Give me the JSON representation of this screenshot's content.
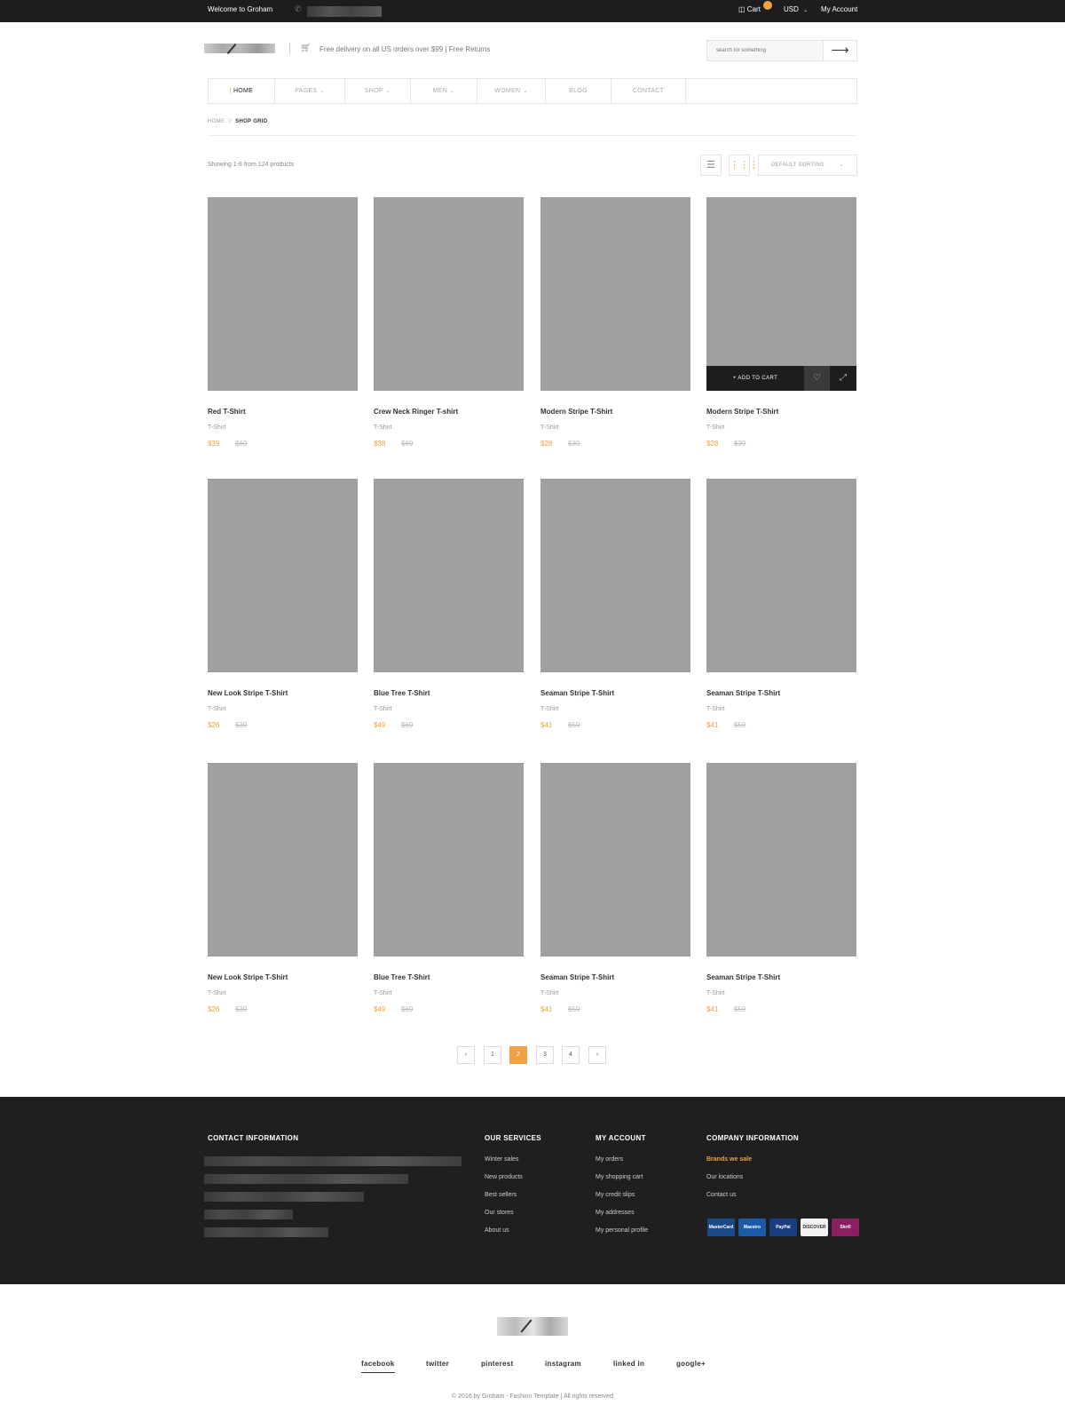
{
  "topbar": {
    "welcome": "Welcome to Groham",
    "cart_label": "Cart",
    "currency": "USD",
    "account": "My Account"
  },
  "header": {
    "delivery_text": "Free delivery on all US orders over $99 | Free Returns",
    "search_placeholder": "search for something"
  },
  "nav": {
    "items": [
      {
        "label": "HOME"
      },
      {
        "label": "PAGES"
      },
      {
        "label": "SHOP"
      },
      {
        "label": "MEN"
      },
      {
        "label": "WOMEN"
      },
      {
        "label": "BLOG"
      },
      {
        "label": "CONTACT"
      }
    ]
  },
  "breadcrumb": {
    "home": "HOME",
    "sep": "//",
    "current": "SHOP GRID"
  },
  "toolbar": {
    "showing": "Showing 1-8 from 124 products",
    "sort": "DEFAULT SORTING"
  },
  "products": [
    {
      "name": "Red T-Shirt",
      "category": "T-Shirt",
      "price": "$39",
      "old_price": "$69"
    },
    {
      "name": "Crew Neck Ringer T-shirt",
      "category": "T-Shirt",
      "price": "$38",
      "old_price": "$69"
    },
    {
      "name": "Modern Stripe T-Shirt",
      "category": "T-Shirt",
      "price": "$28",
      "old_price": "$39"
    },
    {
      "name": "Modern Stripe T-Shirt",
      "category": "T-Shirt",
      "price": "$28",
      "old_price": "$39"
    },
    {
      "name": "New Look Stripe T-Shirt",
      "category": "T-Shirt",
      "price": "$26",
      "old_price": "$39"
    },
    {
      "name": "Blue Tree T-Shirt",
      "category": "T-Shirt",
      "price": "$49",
      "old_price": "$69"
    },
    {
      "name": "Seaman Stripe T-Shirt",
      "category": "T-Shirt",
      "price": "$41",
      "old_price": "$59"
    },
    {
      "name": "Seaman Stripe T-Shirt",
      "category": "T-Shirt",
      "price": "$41",
      "old_price": "$59"
    },
    {
      "name": "New Look Stripe T-Shirt",
      "category": "T-Shirt",
      "price": "$26",
      "old_price": "$39"
    },
    {
      "name": "Blue Tree T-Shirt",
      "category": "T-Shirt",
      "price": "$49",
      "old_price": "$69"
    },
    {
      "name": "Seaman Stripe T-Shirt",
      "category": "T-Shirt",
      "price": "$41",
      "old_price": "$59"
    },
    {
      "name": "Seaman Stripe T-Shirt",
      "category": "T-Shirt",
      "price": "$41",
      "old_price": "$59"
    }
  ],
  "add_to_cart": "+ ADD TO CART",
  "pagination": {
    "prev": "‹",
    "pages": [
      "1",
      "2",
      "3",
      "4"
    ],
    "next": "›",
    "current": "2"
  },
  "footer": {
    "contact_title": "CONTACT INFORMATION",
    "services_title": "OUR SERVICES",
    "services": [
      "Winter sales",
      "New products",
      "Best sellers",
      "Our stores",
      "About us"
    ],
    "account_title": "MY ACCOUNT",
    "account": [
      "My orders",
      "My shopping cart",
      "My credit slips",
      "My addresses",
      "My personal profile"
    ],
    "company_title": "COMPANY INFORMATION",
    "company": [
      "Brands we sale",
      "Our locations",
      "Contact us"
    ],
    "payments": [
      "MasterCard",
      "Maestro",
      "PayPal",
      "DISCOVER",
      "Skrill"
    ]
  },
  "social": [
    "facebook",
    "twitter",
    "pinterest",
    "instagram",
    "linked in",
    "google+"
  ],
  "copyright": "© 2016 by Groham - Fashion Template | All rights reserved",
  "colors": {
    "accent": "#f0a045",
    "dark": "#1d1d1d",
    "placeholder": "#a0a0a0"
  }
}
